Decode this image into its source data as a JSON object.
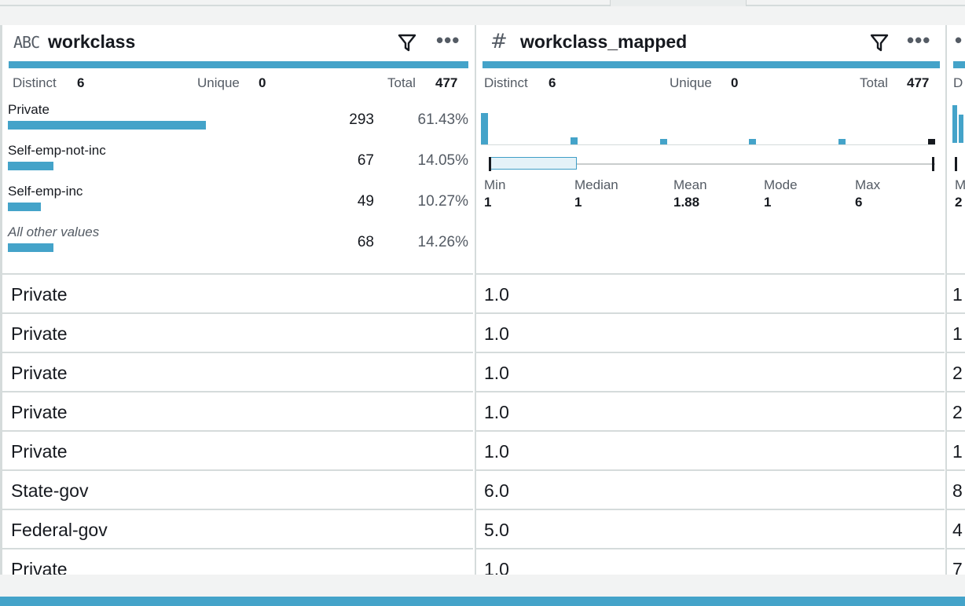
{
  "columns": [
    {
      "type_label": "ABC",
      "name": "workclass",
      "stats": {
        "distinct_label": "Distinct",
        "distinct": "6",
        "unique_label": "Unique",
        "unique": "0",
        "total_label": "Total",
        "total": "477"
      },
      "value_counts": [
        {
          "label": "Private",
          "count": "293",
          "percent": "61.43%",
          "fraction": 0.6143,
          "italic": false
        },
        {
          "label": "Self-emp-not-inc",
          "count": "67",
          "percent": "14.05%",
          "fraction": 0.1405,
          "italic": false
        },
        {
          "label": "Self-emp-inc",
          "count": "49",
          "percent": "10.27%",
          "fraction": 0.1027,
          "italic": false
        },
        {
          "label": "All other values",
          "count": "68",
          "percent": "14.26%",
          "fraction": 0.1426,
          "italic": true
        }
      ],
      "rows": [
        "Private",
        "Private",
        "Private",
        "Private",
        "Private",
        "State-gov",
        "Federal-gov",
        "Private"
      ]
    },
    {
      "type_label": "#",
      "name": "workclass_mapped",
      "stats": {
        "distinct_label": "Distinct",
        "distinct": "6",
        "unique_label": "Unique",
        "unique": "0",
        "total_label": "Total",
        "total": "477"
      },
      "histogram": [
        {
          "bin": 1,
          "count": 293
        },
        {
          "bin": 2,
          "count": 67
        },
        {
          "bin": 3,
          "count": 49
        },
        {
          "bin": 4,
          "count": 34
        },
        {
          "bin": 5,
          "count": 20
        },
        {
          "bin": 6,
          "count": 14
        }
      ],
      "summary": [
        {
          "key": "Min",
          "value": "1"
        },
        {
          "key": "Median",
          "value": "1"
        },
        {
          "key": "Mean",
          "value": "1.88"
        },
        {
          "key": "Mode",
          "value": "1"
        },
        {
          "key": "Max",
          "value": "6"
        }
      ],
      "rows": [
        "1.0",
        "1.0",
        "1.0",
        "1.0",
        "1.0",
        "6.0",
        "5.0",
        "1.0"
      ]
    },
    {
      "stats": {
        "distinct_label": "D"
      },
      "summary_partial": {
        "key": "M",
        "value": "2"
      },
      "rows": [
        "1",
        "1",
        "2",
        "2",
        "1",
        "8",
        "4",
        "7"
      ]
    }
  ],
  "icons": {
    "filter": "filter-icon",
    "more": "more-options-icon"
  },
  "colors": {
    "accent": "#44a3c9",
    "mode_marker": "#16191f"
  }
}
